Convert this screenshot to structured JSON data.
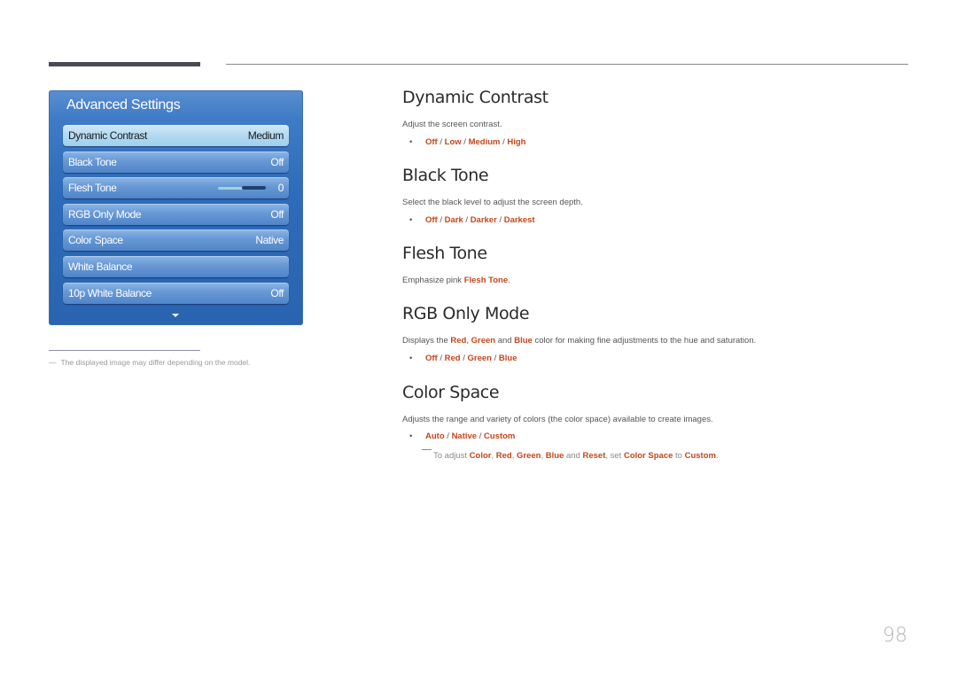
{
  "osd": {
    "title": "Advanced Settings",
    "items": [
      {
        "label": "Dynamic Contrast",
        "value": "Medium",
        "selected": true
      },
      {
        "label": "Black Tone",
        "value": "Off"
      },
      {
        "label": "Flesh Tone",
        "value": "0",
        "slider_level": 0.5
      },
      {
        "label": "RGB Only Mode",
        "value": "Off"
      },
      {
        "label": "Color Space",
        "value": "Native"
      },
      {
        "label": "White Balance",
        "value": ""
      },
      {
        "label": "10p White Balance",
        "value": "Off"
      }
    ],
    "scroll_icon": "chevron-down-icon"
  },
  "footnote": {
    "dash": "―",
    "text": "The displayed image may differ depending on the model."
  },
  "sections": {
    "dynamic_contrast": {
      "title": "Dynamic Contrast",
      "desc": "Adjust the screen contrast.",
      "options": [
        "Off",
        "Low",
        "Medium",
        "High"
      ]
    },
    "black_tone": {
      "title": "Black Tone",
      "desc": "Select the black level to adjust the screen depth.",
      "options": [
        "Off",
        "Dark",
        "Darker",
        "Darkest"
      ]
    },
    "flesh_tone": {
      "title": "Flesh Tone",
      "desc_prefix": "Emphasize pink ",
      "desc_hl": "Flesh Tone",
      "desc_suffix": "."
    },
    "rgb_only_mode": {
      "title": "RGB Only Mode",
      "desc_parts": {
        "p1": "Displays the ",
        "h1": "Red",
        "p2": ", ",
        "h2": "Green",
        "p3": " and ",
        "h3": "Blue",
        "p4": " color for making fine adjustments to the hue and saturation."
      },
      "options": [
        "Off",
        "Red",
        "Green",
        "Blue"
      ]
    },
    "color_space": {
      "title": "Color Space",
      "desc": "Adjusts the range and variety of colors (the color space) available to create images.",
      "options": [
        "Auto",
        "Native",
        "Custom"
      ],
      "note_parts": {
        "p1": "To adjust ",
        "h1": "Color",
        "p2": ", ",
        "h2": "Red",
        "p3": ", ",
        "h3": "Green",
        "p4": ", ",
        "h4": "Blue",
        "p5": " and ",
        "h5": "Reset",
        "p6": ", set ",
        "h6": "Color Space",
        "p7": " to ",
        "h7": "Custom",
        "p8": "."
      }
    }
  },
  "bullet": "•",
  "separator": " / ",
  "colors": {
    "highlight": "#c4461b",
    "osd_panel": "#2e6bb8",
    "osd_selected": "#b7dcf2"
  },
  "page_number": "98"
}
